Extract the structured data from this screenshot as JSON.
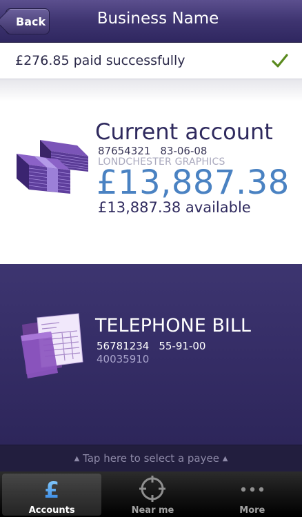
{
  "navbar": {
    "back_label": "Back",
    "title": "Business Name"
  },
  "confirmation": {
    "message": "£276.85 paid successfully",
    "icon": "check-icon",
    "icon_color": "#5a8a1e"
  },
  "from_account": {
    "icon": "money-stack-icon",
    "title": "Current account",
    "account_number": "87654321",
    "sort_code": "83-06-08",
    "holder": "LONDCHESTER GRAPHICS",
    "balance": "£13,887.38",
    "available": "£13,887.38 available",
    "balance_color": "#4a82c2"
  },
  "payee": {
    "icon": "bill-document-icon",
    "title": "TELEPHONE BILL",
    "account_number": "56781234",
    "sort_code": "55-91-00",
    "reference": "40035910"
  },
  "select_payee": {
    "label": "Tap here to select a payee"
  },
  "tabs": [
    {
      "label": "Accounts",
      "icon": "pound-icon",
      "active": true
    },
    {
      "label": "Near me",
      "icon": "crosshair-icon",
      "active": false
    },
    {
      "label": "More",
      "icon": "more-dots-icon",
      "active": false
    }
  ]
}
